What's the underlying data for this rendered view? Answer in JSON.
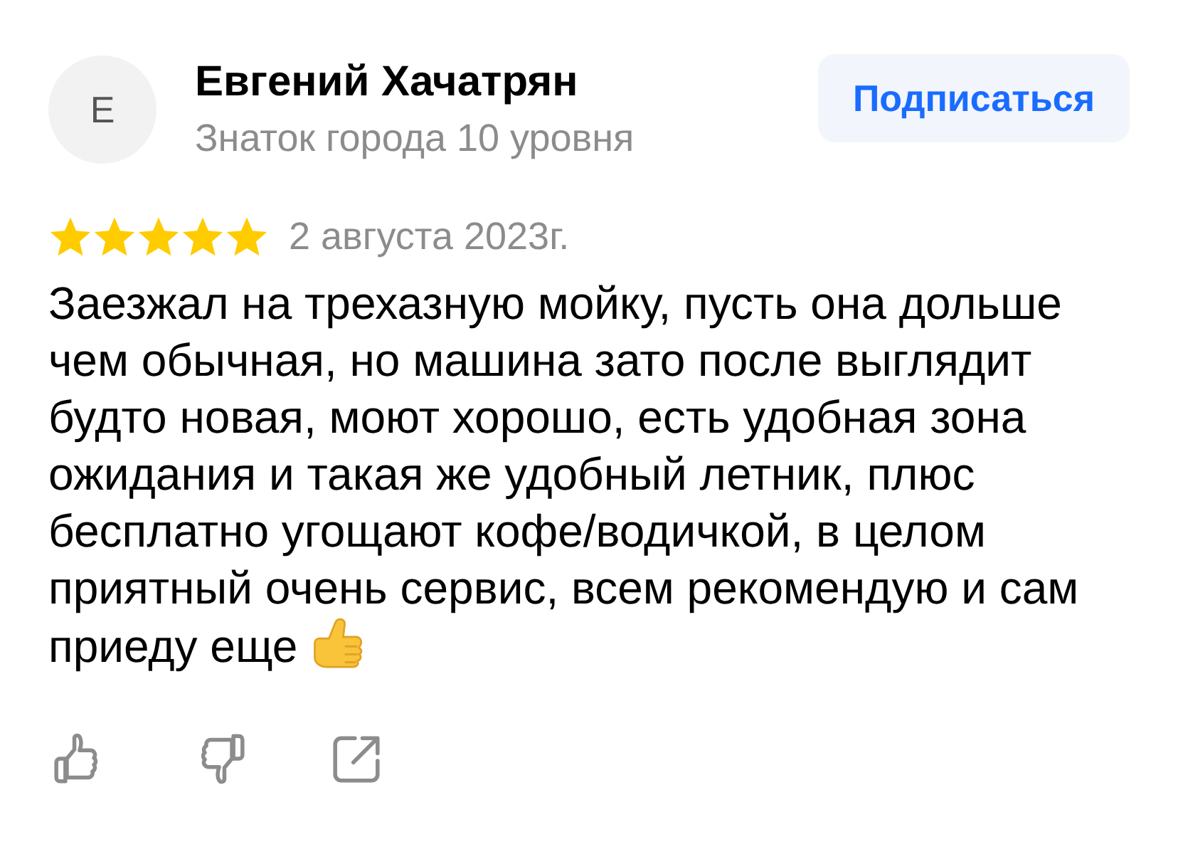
{
  "author": {
    "initial": "Е",
    "name": "Евгений Хачатрян",
    "subtitle": "Знаток города 10 уровня"
  },
  "subscribe_button": {
    "label": "Подписаться"
  },
  "review": {
    "stars": 5,
    "date": "2 августа 2023г.",
    "text": "Заезжал на трехазную мойку, пусть она дольше чем обычная, но машина зато после выглядит будто новая, моют хорошо, есть удобная зона ожидания и такая же удобный летник, плюс бесплатно угощают кофе/водичкой, в целом приятный очень сервис, всем рекомендую и сам приеду еще"
  },
  "actions": [
    {
      "kind": "like"
    },
    {
      "kind": "dislike"
    },
    {
      "kind": "share"
    }
  ]
}
